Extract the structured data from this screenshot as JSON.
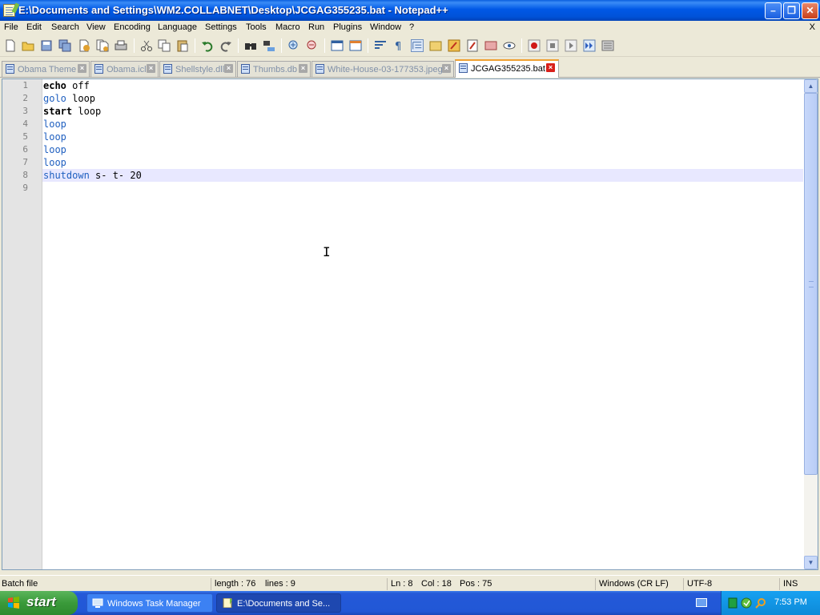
{
  "window": {
    "title": "E:\\Documents and Settings\\WM2.COLLABNET\\Desktop\\JCGAG355235.bat - Notepad++",
    "minimize_label": "–",
    "maximize_label": "❐",
    "close_label": "✕"
  },
  "menu": {
    "items": [
      "File",
      "Edit",
      "Search",
      "View",
      "Encoding",
      "Language",
      "Settings",
      "Tools",
      "Macro",
      "Run",
      "Plugins",
      "Window",
      "?"
    ],
    "close_doc": "X"
  },
  "toolbar": {
    "icons": [
      "new-file-icon",
      "open-file-icon",
      "save-icon",
      "save-all-icon",
      "close-icon",
      "close-all-icon",
      "print-icon",
      "cut-icon",
      "copy-icon",
      "paste-icon",
      "undo-icon",
      "redo-icon",
      "find-icon",
      "replace-icon",
      "zoom-in-icon",
      "zoom-out-icon",
      "sync-vertical-icon",
      "sync-horizontal-icon",
      "word-wrap-icon",
      "show-all-chars-icon",
      "indent-guide-icon",
      "folder-icon",
      "function-list-icon",
      "document-map-icon",
      "panel-icon",
      "eye-icon",
      "record-macro-icon",
      "stop-record-icon",
      "play-macro-icon",
      "run-macro-multiple-icon",
      "save-macro-icon"
    ]
  },
  "tabs": [
    {
      "label": "Obama Theme",
      "active": false
    },
    {
      "label": "Obama.icl",
      "active": false
    },
    {
      "label": "Shellstyle.dll",
      "active": false
    },
    {
      "label": "Thumbs.db",
      "active": false
    },
    {
      "label": "White-House-03-177353.jpeg",
      "active": false
    },
    {
      "label": "JCGAG355235.bat",
      "active": true
    }
  ],
  "editor": {
    "current_line": 8,
    "lines": [
      {
        "num": "1",
        "tokens": [
          {
            "t": "echo",
            "c": "kw"
          },
          {
            "t": " off",
            "c": "txt"
          }
        ]
      },
      {
        "num": "2",
        "tokens": [
          {
            "t": "golo",
            "c": "lbl"
          },
          {
            "t": " loop",
            "c": "txt"
          }
        ]
      },
      {
        "num": "3",
        "tokens": [
          {
            "t": "start",
            "c": "kw"
          },
          {
            "t": " loop",
            "c": "txt"
          }
        ]
      },
      {
        "num": "4",
        "tokens": [
          {
            "t": "loop",
            "c": "lbl"
          }
        ]
      },
      {
        "num": "5",
        "tokens": [
          {
            "t": "loop",
            "c": "lbl"
          }
        ]
      },
      {
        "num": "6",
        "tokens": [
          {
            "t": "loop",
            "c": "lbl"
          }
        ]
      },
      {
        "num": "7",
        "tokens": [
          {
            "t": "loop",
            "c": "lbl"
          }
        ]
      },
      {
        "num": "8",
        "tokens": [
          {
            "t": "shutdown",
            "c": "cmd"
          },
          {
            "t": " s- t- 20",
            "c": "txt"
          }
        ]
      },
      {
        "num": "9",
        "tokens": []
      }
    ]
  },
  "status": {
    "file_type": "Batch file",
    "length": "length : 76",
    "lines": "lines : 9",
    "ln": "Ln : 8",
    "col": "Col : 18",
    "pos": "Pos : 75",
    "eol": "Windows (CR LF)",
    "encoding": "UTF-8",
    "mode": "INS"
  },
  "taskbar": {
    "start_label": "start",
    "tasks": [
      {
        "label": "Windows Task Manager",
        "active": false
      },
      {
        "label": "E:\\Documents and Se...",
        "active": true
      }
    ],
    "clock": "7:53 PM"
  },
  "colors": {
    "keyword": "#000000",
    "label": "#2060c0",
    "current_line_bg": "#e8e8ff",
    "title_bar": "#0058e6"
  }
}
